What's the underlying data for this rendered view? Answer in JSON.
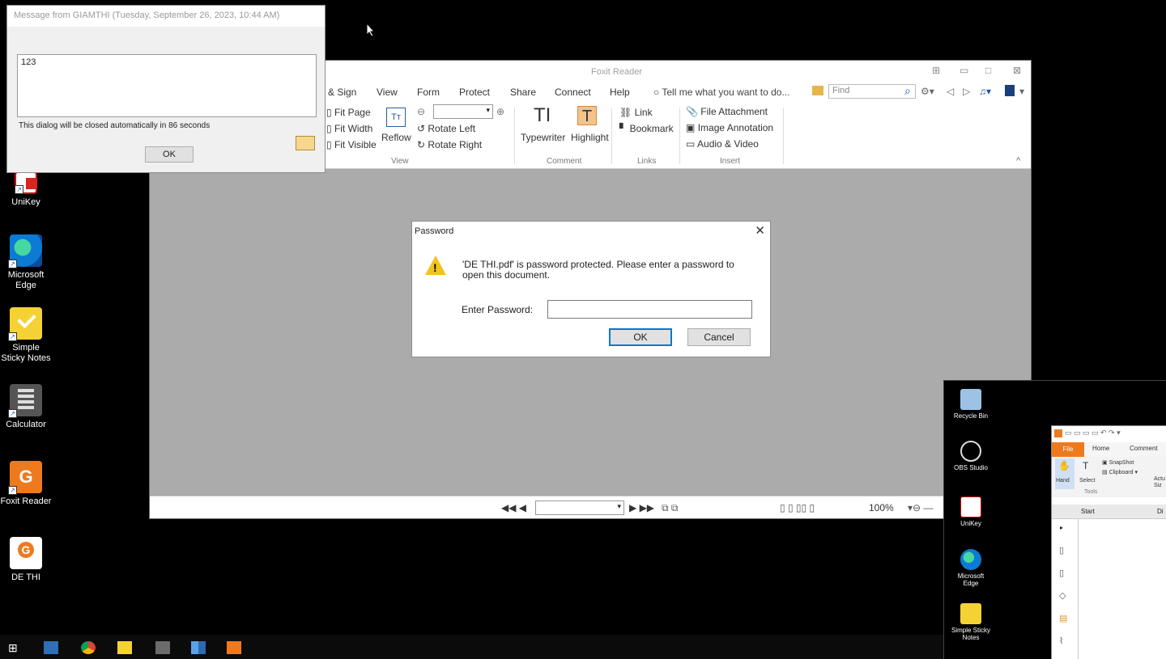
{
  "colors": {
    "accent": "#ee7a1e",
    "dialog_focus": "#0078d7",
    "warning": "#f3c31b"
  },
  "desktop_icons": [
    {
      "label": "UniKey",
      "icon": "unikey-icon"
    },
    {
      "label": "Microsoft Edge",
      "icon": "edge-icon"
    },
    {
      "label": "Simple Sticky Notes",
      "icon": "sticky-notes-icon"
    },
    {
      "label": "Calculator",
      "icon": "calculator-icon"
    },
    {
      "label": "Foxit Reader",
      "icon": "foxit-reader-icon"
    },
    {
      "label": "DE THI",
      "icon": "pdf-file-icon"
    }
  ],
  "message_dialog": {
    "title": "Message from GIAMTHI (Tuesday, September 26, 2023, 10:44 AM)",
    "text": "123",
    "autoclose": "This dialog will be closed automatically in 86 seconds",
    "ok": "OK"
  },
  "foxit": {
    "title": "Foxit Reader",
    "menu": [
      "& Sign",
      "View",
      "Form",
      "Protect",
      "Share",
      "Connect",
      "Help"
    ],
    "tell_me": "Tell me what you want to do...",
    "find_placeholder": "Find",
    "ribbon": {
      "fit_page": "Fit Page",
      "fit_width": "Fit Width",
      "fit_visible": "Fit Visible",
      "reflow": "Reflow",
      "rotate_left": "Rotate Left",
      "rotate_right": "Rotate Right",
      "typewriter": "Typewriter",
      "highlight": "Highlight",
      "link": "Link",
      "bookmark": "Bookmark",
      "file_attachment": "File Attachment",
      "image_annotation": "Image Annotation",
      "audio_video": "Audio & Video",
      "group_view": "View",
      "group_comment": "Comment",
      "group_links": "Links",
      "group_insert": "Insert"
    },
    "status": {
      "zoom": "100%"
    }
  },
  "password_dialog": {
    "title": "Password",
    "message": "'DE THI.pdf' is password protected. Please enter a password to open this document.",
    "label": "Enter Password:",
    "ok": "OK",
    "cancel": "Cancel"
  },
  "taskbar": [
    "start-icon",
    "file-explorer-icon",
    "chrome-icon",
    "sticky-notes-icon",
    "calculator-icon",
    "app-icon",
    "foxit-icon"
  ],
  "desktop2": {
    "icons": [
      "Recycle Bin",
      "OBS Studio",
      "UniKey",
      "Microsoft Edge",
      "Simple Sticky Notes"
    ],
    "foxit": {
      "file_tab": "File",
      "tabs": [
        "Home",
        "Comment"
      ],
      "hand": "Hand",
      "select": "Select",
      "snapshot": "SnapShot",
      "clipboard": "Clipboard",
      "actual": "Actu",
      "size_abbr": "Siz",
      "tools": "Tools",
      "start_tab": "Start",
      "next_tab": "Di"
    }
  }
}
